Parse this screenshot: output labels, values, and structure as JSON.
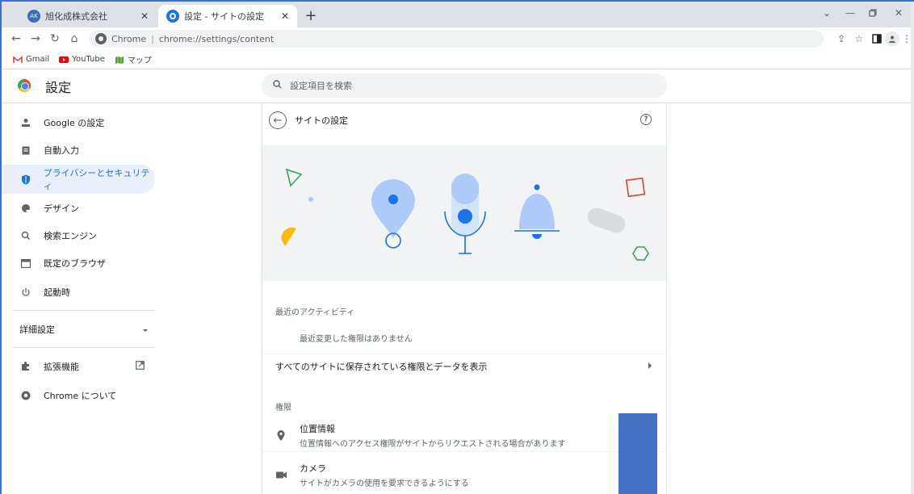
{
  "tabs": [
    {
      "favicon_text": "AK",
      "title": "旭化成株式会社"
    },
    {
      "title": "設定 - サイトの設定"
    }
  ],
  "omnibox": {
    "scheme": "Chrome",
    "url": "chrome://settings/content"
  },
  "bookmarks": [
    {
      "label": "Gmail"
    },
    {
      "label": "YouTube"
    },
    {
      "label": "マップ"
    }
  ],
  "settings": {
    "title": "設定",
    "search_placeholder": "設定項目を検索"
  },
  "sidebar": {
    "items": [
      {
        "label": "Google の設定",
        "icon": "person-icon"
      },
      {
        "label": "自動入力",
        "icon": "clipboard-icon"
      },
      {
        "label": "プライバシーとセキュリティ",
        "icon": "shield-icon",
        "active": true
      },
      {
        "label": "デザイン",
        "icon": "palette-icon"
      },
      {
        "label": "検索エンジン",
        "icon": "search-icon"
      },
      {
        "label": "既定のブラウザ",
        "icon": "browser-icon"
      },
      {
        "label": "起動時",
        "icon": "power-icon"
      }
    ],
    "advanced": "詳細設定",
    "extensions": "拡張機能",
    "about": "Chrome について"
  },
  "main": {
    "page_title": "サイトの設定",
    "recent_activity_title": "最近のアクティビティ",
    "recent_activity_empty": "最近変更した権限はありません",
    "all_sites_link": "すべてのサイトに保存されている権限とデータを表示",
    "permissions_title": "権限",
    "permissions": [
      {
        "title": "位置情報",
        "subtitle": "位置情報へのアクセス権限がサイトからリクエストされる場合があります",
        "icon": "location-pin-icon"
      },
      {
        "title": "カメラ",
        "subtitle": "サイトがカメラの使用を要求できるようにする",
        "icon": "camera-icon"
      }
    ]
  },
  "colors": {
    "accent": "#1a73e8",
    "active_bg": "#e8f0fe",
    "banner_bg": "#f1f3f4",
    "redaction": "#4472c4"
  }
}
